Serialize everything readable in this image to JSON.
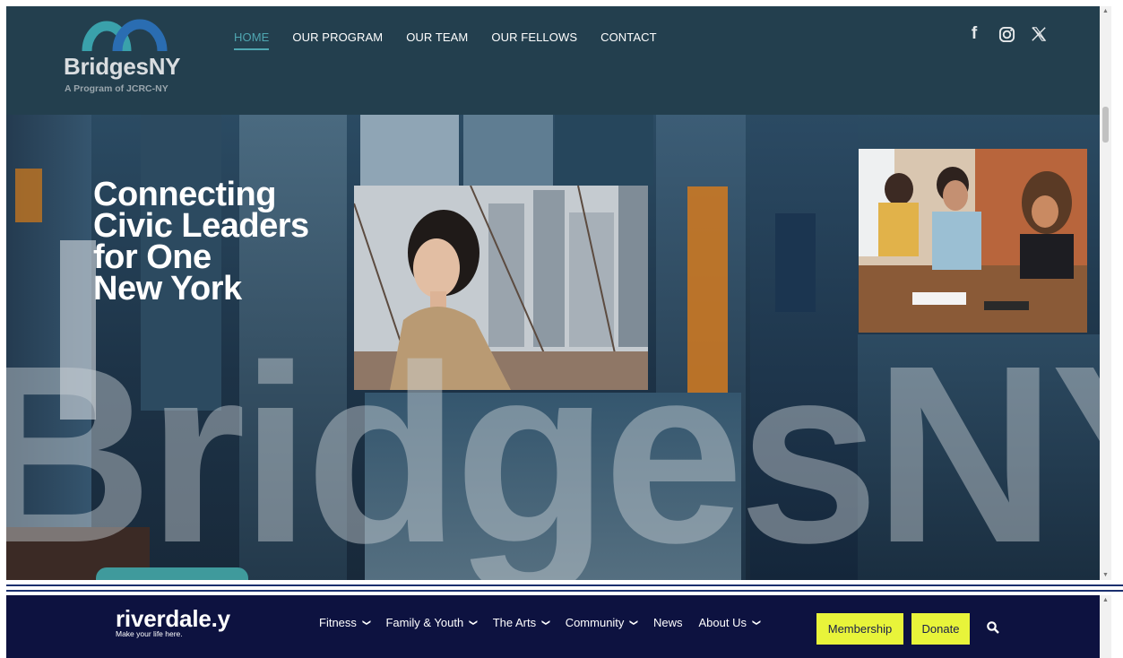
{
  "site1": {
    "logo": {
      "title": "BridgesNY",
      "subtitle": "A Program of JCRC-NY"
    },
    "nav": [
      {
        "label": "HOME",
        "active": true
      },
      {
        "label": "OUR PROGRAM",
        "active": false
      },
      {
        "label": "OUR TEAM",
        "active": false
      },
      {
        "label": "OUR FELLOWS",
        "active": false
      },
      {
        "label": "CONTACT",
        "active": false
      }
    ],
    "social": [
      {
        "name": "facebook-icon",
        "glyph": "f"
      },
      {
        "name": "instagram-icon",
        "glyph": "◎"
      },
      {
        "name": "x-icon",
        "glyph": "𝕏"
      }
    ],
    "hero": {
      "title_lines": [
        "Connecting",
        "Civic Leaders",
        "for One",
        "New York"
      ],
      "watermark": "BridgesNY"
    },
    "colors": {
      "header_bg": "#233f4e",
      "accent": "#4fa6b1"
    }
  },
  "site2": {
    "logo": {
      "title": "riverdale.y",
      "tagline": "Make your life here."
    },
    "nav": [
      {
        "label": "Fitness",
        "dropdown": true
      },
      {
        "label": "Family & Youth",
        "dropdown": true
      },
      {
        "label": "The Arts",
        "dropdown": true
      },
      {
        "label": "Community",
        "dropdown": true
      },
      {
        "label": "News",
        "dropdown": false
      },
      {
        "label": "About Us",
        "dropdown": true
      }
    ],
    "buttons": {
      "membership": "Membership",
      "donate": "Donate"
    },
    "colors": {
      "nav_bg": "#0d1240",
      "button_bg": "#e8f43a"
    }
  }
}
